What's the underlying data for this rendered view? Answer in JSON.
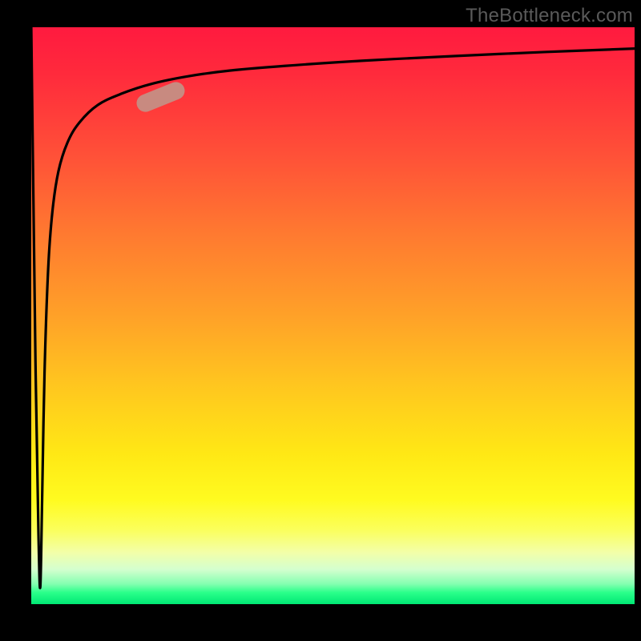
{
  "watermark": "TheBottleneck.com",
  "chart_data": {
    "type": "line",
    "title": "",
    "xlabel": "",
    "ylabel": "",
    "xlim": [
      0,
      100
    ],
    "ylim": [
      0,
      100
    ],
    "gradient_colors": {
      "top": "#ff1a3f",
      "upper_mid": "#ff9a2a",
      "mid": "#ffe815",
      "lower": "#fbff5a",
      "bottom": "#00e874"
    },
    "series": [
      {
        "name": "bottleneck-curve",
        "x": [
          0,
          0.3,
          0.7,
          1.2,
          1.5,
          1.8,
          2.2,
          2.8,
          3.5,
          4.5,
          6,
          8,
          11,
          15,
          20,
          26,
          33,
          42,
          55,
          70,
          85,
          100
        ],
        "y": [
          100,
          75,
          42,
          12,
          3,
          18,
          40,
          58,
          68,
          75,
          80,
          83.5,
          86.5,
          88.5,
          90.2,
          91.5,
          92.5,
          93.3,
          94.2,
          95,
          95.7,
          96.3
        ]
      }
    ],
    "annotations": [
      {
        "name": "highlight-marker",
        "x": 21.5,
        "y": 87.9,
        "angle_deg": -22,
        "color": "#c88a80"
      }
    ]
  }
}
